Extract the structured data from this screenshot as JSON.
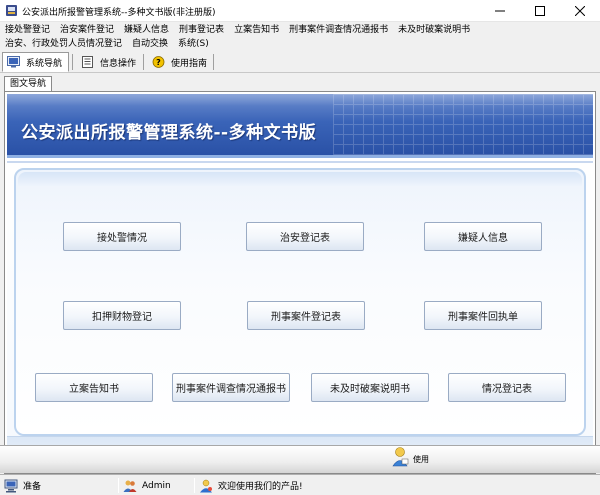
{
  "window": {
    "title": "公安派出所报警管理系统--多种文书版(非注册版)",
    "minimize_icon": "minimize-icon",
    "maximize_icon": "maximize-icon",
    "close_icon": "close-icon"
  },
  "menu": {
    "row1": [
      "接处警登记",
      "治安案件登记",
      "嫌疑人信息",
      "刑事登记表",
      "立案告知书",
      "刑事案件调查情况通报书",
      "未及时破案说明书"
    ],
    "row2": [
      "治安、行政处罚人员情况登记",
      "自动交换",
      "系统(S)"
    ]
  },
  "toolbar": {
    "items": [
      {
        "label": "系统导航",
        "icon": "navigation-icon",
        "active": true
      },
      {
        "label": "信息操作",
        "icon": "list-icon",
        "active": false
      },
      {
        "label": "使用指南",
        "icon": "help-icon",
        "active": false
      }
    ]
  },
  "subtab": {
    "label": "图文导航"
  },
  "banner": {
    "title": "公安派出所报警管理系统--多种文书版"
  },
  "nav_buttons": {
    "row1": [
      "接处警情况",
      "治安登记表",
      "嫌疑人信息"
    ],
    "row2": [
      "扣押财物登记",
      "刑事案件登记表",
      "刑事案件回执单"
    ],
    "row3": [
      "立案告知书",
      "刑事案件调查情况通报书",
      "未及时破案说明书",
      "情况登记表"
    ]
  },
  "help": {
    "label": "使用",
    "icon": "person-help-icon"
  },
  "status": {
    "ready": "准备",
    "user": "Admin",
    "welcome": "欢迎使用我们的产品!",
    "ready_icon": "computer-icon",
    "user_icon": "users-icon",
    "welcome_icon": "welcome-icon"
  },
  "colors": {
    "banner_blue": "#2a51a6",
    "accent_light": "#bcd3ee"
  }
}
